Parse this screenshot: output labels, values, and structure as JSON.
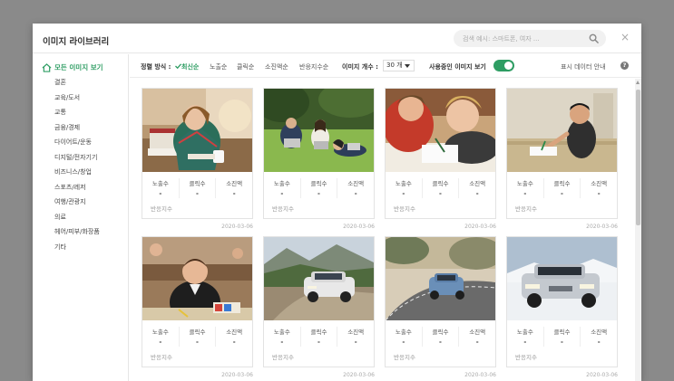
{
  "modal": {
    "title": "이미지 라이브러리",
    "search_placeholder": "검색 예시: 스마트폰, 여자 ...",
    "close_symbol": "×"
  },
  "sidebar": {
    "all_label": "모든 이미지 보기",
    "items": [
      {
        "label": "결혼"
      },
      {
        "label": "교육/도서"
      },
      {
        "label": "교통"
      },
      {
        "label": "금융/경제"
      },
      {
        "label": "다이어트/운동"
      },
      {
        "label": "디지털/전자기기"
      },
      {
        "label": "비즈니스/창업"
      },
      {
        "label": "스포츠/레저"
      },
      {
        "label": "여행/관광지"
      },
      {
        "label": "의료"
      },
      {
        "label": "헤어/피부/화장품"
      },
      {
        "label": "기타"
      }
    ]
  },
  "toolbar": {
    "sort_label": "정렬 방식 :",
    "sort_active": "최신순",
    "sort_options": [
      "노출순",
      "클릭순",
      "소진액순",
      "반응지수순"
    ],
    "count_label": "이미지 개수 :",
    "count_value": "30 개",
    "in_use_label": "사용중인 이미지 보기",
    "in_use_on": true,
    "info_label": "표시 데이터 안내",
    "help_symbol": "?"
  },
  "stat_labels": {
    "impressions": "노출수",
    "clicks": "클릭수",
    "spend": "소진액",
    "reaction": "반응지수"
  },
  "cards": [
    {
      "scene": "woman-studying-books",
      "impressions": "-",
      "clicks": "-",
      "spend": "-",
      "date": "2020-03-06"
    },
    {
      "scene": "students-on-grass-laptops",
      "impressions": "-",
      "clicks": "-",
      "spend": "-",
      "date": "2020-03-06"
    },
    {
      "scene": "children-drawing",
      "impressions": "-",
      "clicks": "-",
      "spend": "-",
      "date": "2020-03-06"
    },
    {
      "scene": "boy-writing-at-desk",
      "impressions": "-",
      "clicks": "-",
      "spend": "-",
      "date": "2020-03-06"
    },
    {
      "scene": "schoolboy-in-classroom",
      "impressions": "-",
      "clicks": "-",
      "spend": "-",
      "date": "2020-03-06"
    },
    {
      "scene": "suv-on-mountain-road",
      "impressions": "-",
      "clicks": "-",
      "spend": "-",
      "date": "2020-03-06"
    },
    {
      "scene": "car-driving-road",
      "impressions": "-",
      "clicks": "-",
      "spend": "-",
      "date": "2020-03-06"
    },
    {
      "scene": "silver-suv-snow",
      "impressions": "-",
      "clicks": "-",
      "spend": "-",
      "date": "2020-03-06"
    }
  ],
  "colors": {
    "accent": "#2e9d63",
    "overlay": "#8a8a8a"
  }
}
